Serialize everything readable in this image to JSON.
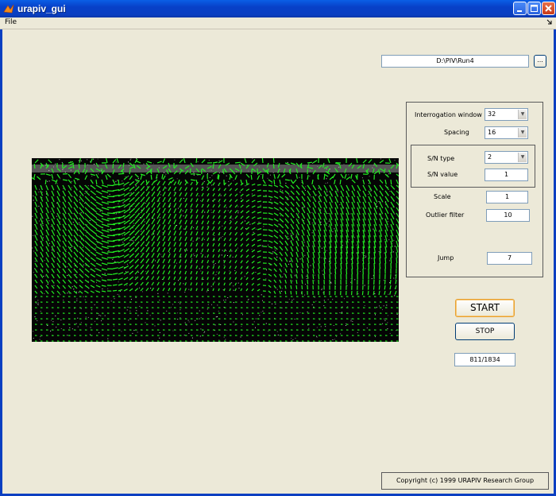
{
  "window": {
    "title": "urapiv_gui"
  },
  "menu": {
    "file": "File"
  },
  "path": {
    "value": "D:\\PIV\\Run4",
    "browse_label": "..."
  },
  "params": {
    "interrogation_label": "Interrogation window",
    "interrogation_value": "32",
    "spacing_label": "Spacing",
    "spacing_value": "16",
    "sn_type_label": "S/N type",
    "sn_type_value": "2",
    "sn_value_label": "S/N value",
    "sn_value": "1",
    "scale_label": "Scale",
    "scale_value": "1",
    "outlier_label": "Outlier filter",
    "outlier_value": "10",
    "jump_label": "Jump",
    "jump_value": "7"
  },
  "controls": {
    "start_label": "START",
    "stop_label": "STOP",
    "progress": "811/1834"
  },
  "footer": {
    "copyright": "Copyright (c) 1999 URAPIV Research Group"
  },
  "colors": {
    "vector": "#22ee22",
    "title_bar": "#0a3fc1",
    "panel_bg": "#ece9d8"
  }
}
